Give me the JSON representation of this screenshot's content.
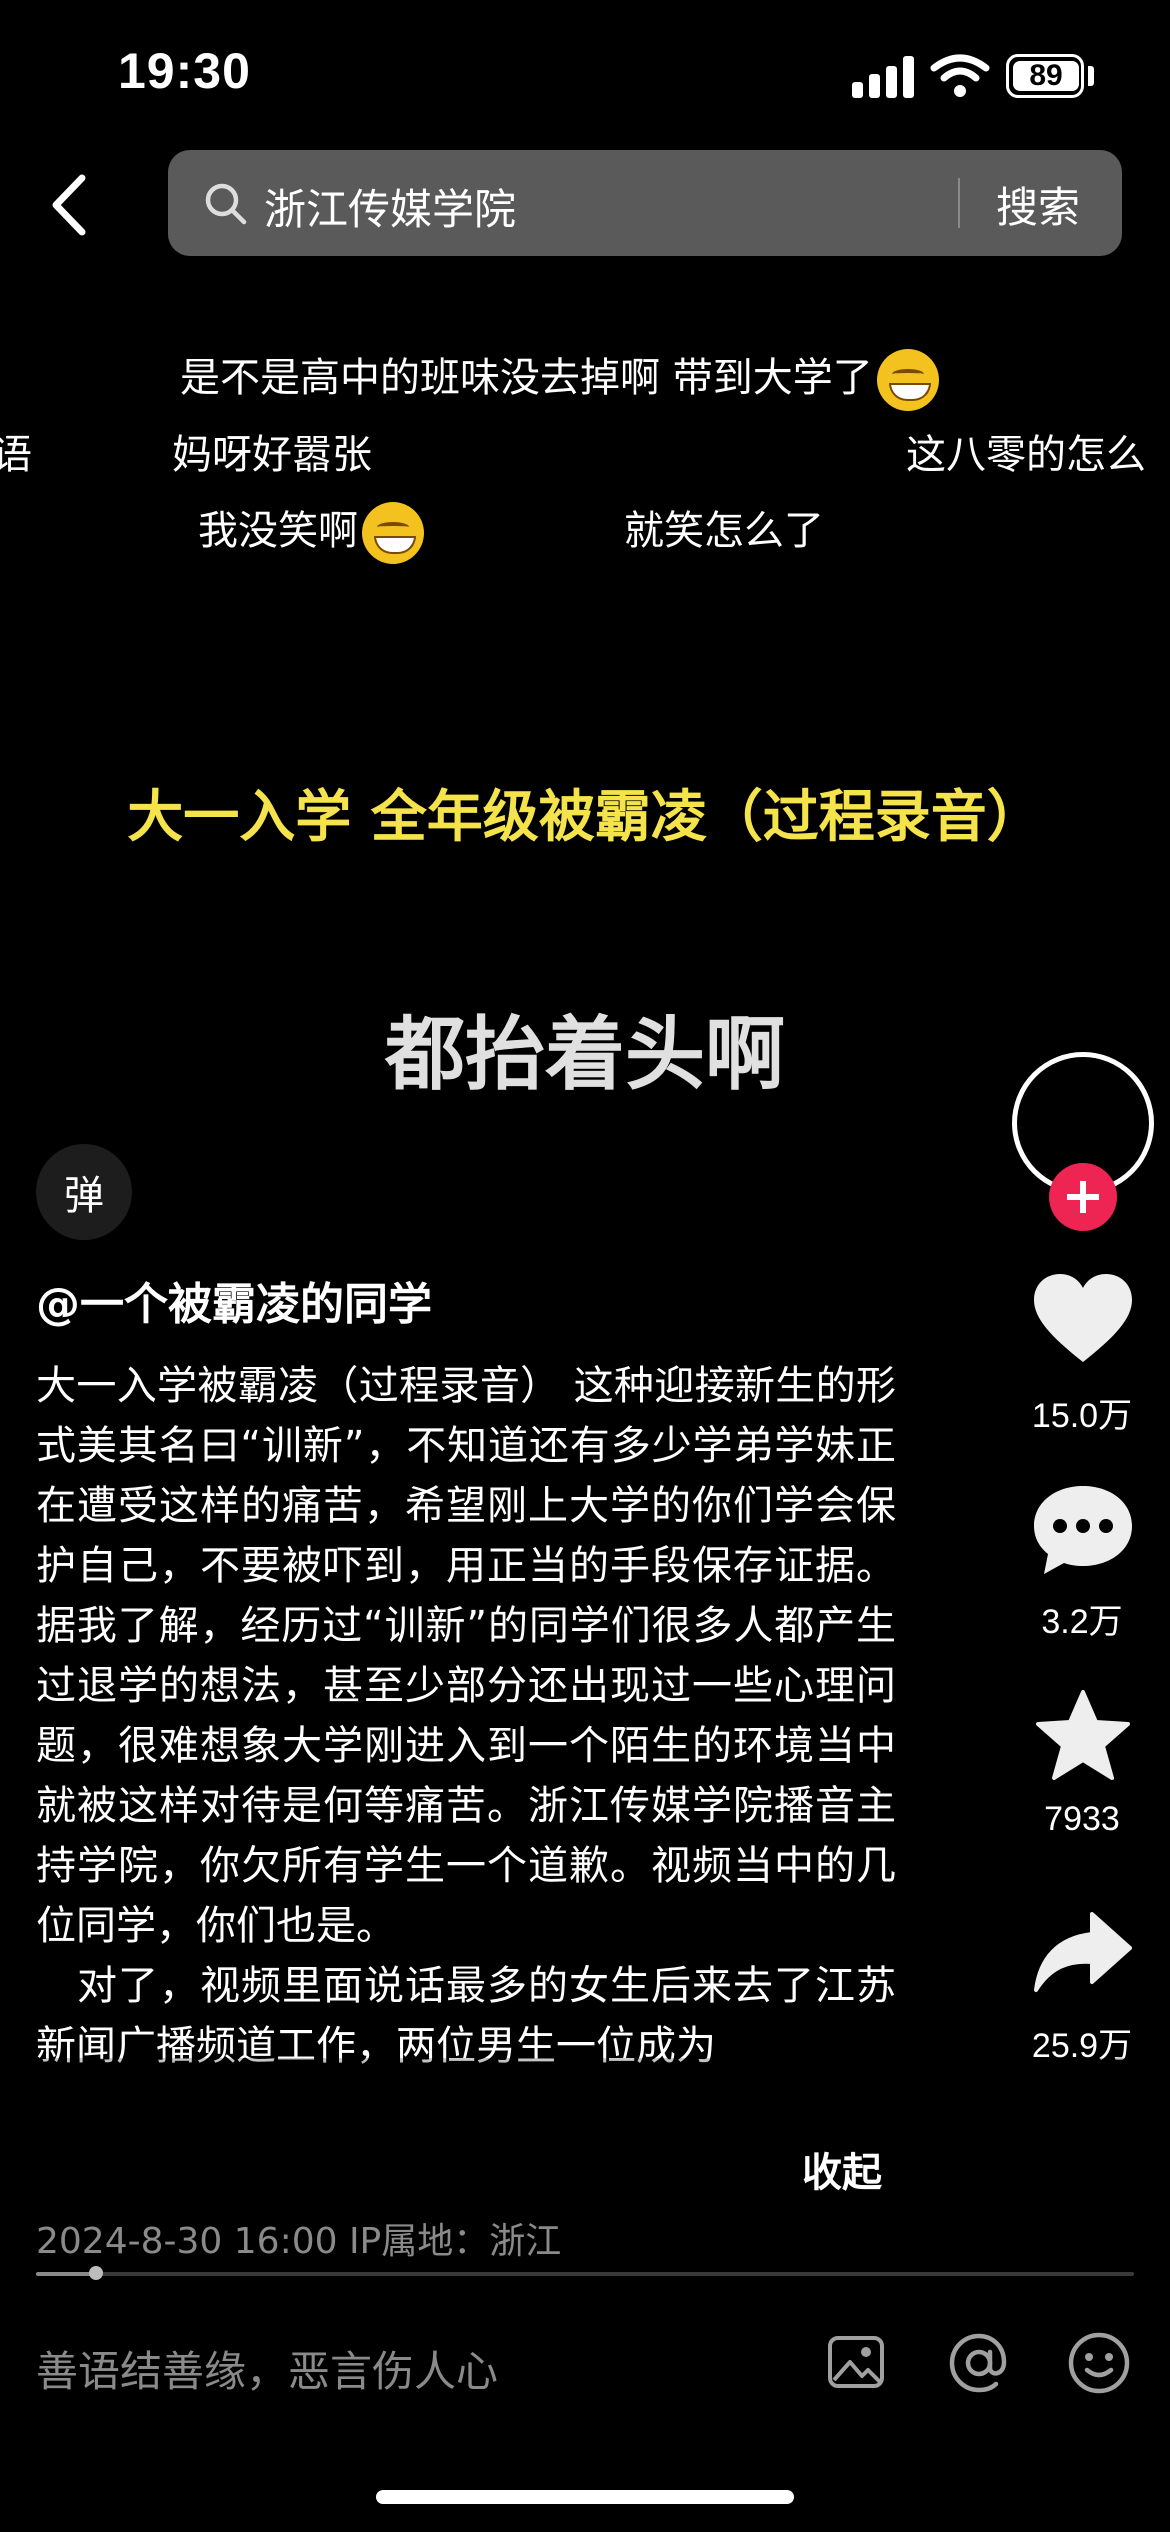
{
  "status_bar": {
    "time": "19:30",
    "battery": "89"
  },
  "search": {
    "query": "浙江传媒学院",
    "button_label": "搜索"
  },
  "danmaku": {
    "line1": "是不是高中的班味没去掉啊 带到大学了",
    "line2a": "妈呀好嚣张",
    "line2b": "这八零的怎么",
    "line3a": "我没笑啊",
    "line3b": "就笑怎么了"
  },
  "video": {
    "title_caption": "大一入学 全年级被霸凌（过程录音）",
    "big_caption": "都抬着头啊"
  },
  "actions": {
    "likes": "15.0万",
    "comments": "3.2万",
    "favorites": "7933",
    "shares": "25.9万"
  },
  "danmaku_toggle": "弹",
  "post": {
    "author": "@一个被霸凌的同学",
    "description": "大一入学被霸凌（过程录音） 这种迎接新生的形式美其名曰“训新”，不知道还有多少学弟学妹正在遭受这样的痛苦，希望刚上大学的你们学会保护自己，不要被吓到，用正当的手段保存证据。据我了解，经历过“训新”的同学们很多人都产生过退学的想法，甚至少部分还出现过一些心理问题，很难想象大学刚进入到一个陌生的环境当中就被这样对待是何等痛苦。浙江传媒学院播音主持学院，你欠所有学生一个道歉。视频当中的几位同学，你们也是。",
    "description_2": "　对了，视频里面说话最多的女生后来去了江苏新闻广播频道工作，两位男生一位成为",
    "collapse_label": "收起",
    "meta": "2024-8-30 16:00  IP属地：浙江"
  },
  "playback": {
    "progress_fraction": 0.055
  },
  "comment_bar": {
    "placeholder": "善语结善缘，恶言伤人心"
  },
  "colors": {
    "caption_yellow": "#f4e34b",
    "follow_red": "#ee2452",
    "search_bg": "#5a5a5a"
  }
}
